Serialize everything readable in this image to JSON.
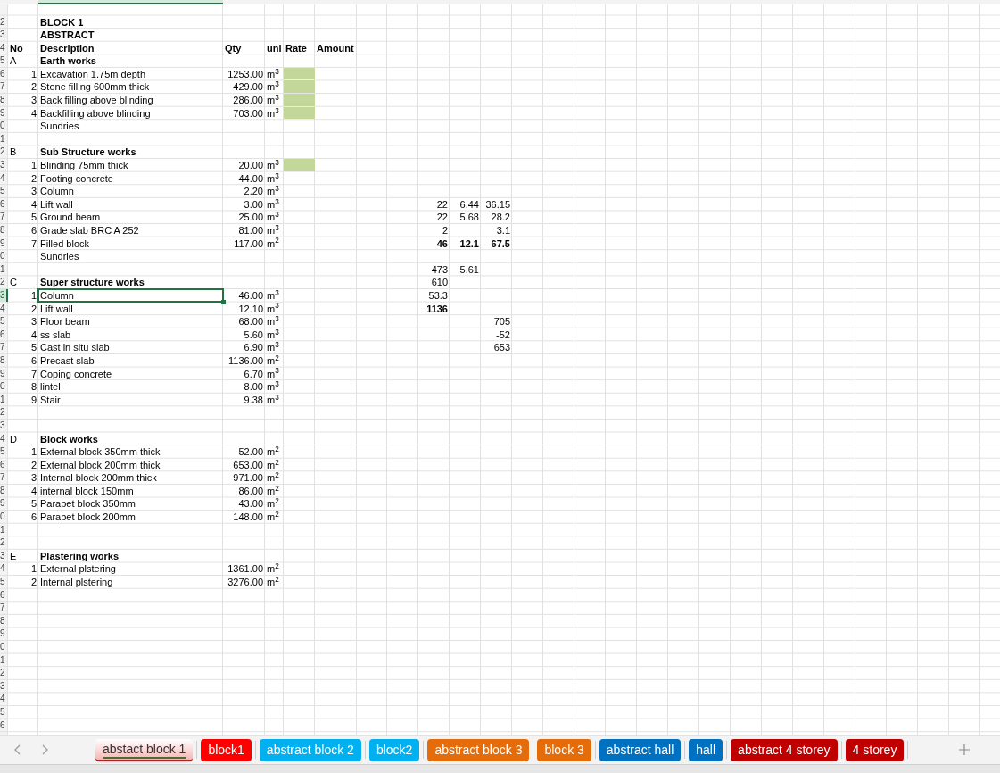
{
  "sheet": {
    "rows": [
      {
        "kind": "blank",
        "selected": false,
        "highlight": false
      },
      {
        "label": "2",
        "kind": "title",
        "selected": false,
        "highlight": false,
        "description": "BLOCK 1"
      },
      {
        "label": "3",
        "kind": "title",
        "selected": false,
        "highlight": false,
        "description": "ABSTRACT"
      },
      {
        "label": "4",
        "kind": "header",
        "selected": false,
        "highlight": false,
        "no": "No",
        "description": "Description",
        "qty": "Qty",
        "unit": "uni",
        "rate": "Rate",
        "amount": "Amount"
      },
      {
        "label": "5",
        "kind": "section",
        "selected": false,
        "highlight": false,
        "no": "A",
        "description": "Earth works"
      },
      {
        "label": "6",
        "kind": "item",
        "selected": false,
        "highlight": true,
        "no": "1",
        "description": "Excavation 1.75m depth",
        "qty": "1253.00",
        "unit": "m$^{3}$"
      },
      {
        "label": "7",
        "kind": "item",
        "selected": false,
        "highlight": true,
        "no": "2",
        "description": "Stone filling 600mm thick",
        "qty": "429.00",
        "unit": "m$^{3}$"
      },
      {
        "label": "8",
        "kind": "item",
        "selected": false,
        "highlight": true,
        "no": "3",
        "description": "Back filling above blinding",
        "qty": "286.00",
        "unit": "m$^{3}$"
      },
      {
        "label": "9",
        "kind": "item",
        "selected": false,
        "highlight": true,
        "no": "4",
        "description": "Backfilling above blinding",
        "qty": "703.00",
        "unit": "m$^{3}$"
      },
      {
        "label": "0",
        "kind": "item",
        "selected": false,
        "highlight": false,
        "description": "Sundries"
      },
      {
        "label": "1",
        "kind": "blank",
        "selected": false,
        "highlight": false
      },
      {
        "label": "2",
        "kind": "section",
        "selected": false,
        "highlight": false,
        "no": "B",
        "description": "Sub Structure works"
      },
      {
        "label": "3",
        "kind": "item",
        "selected": false,
        "highlight": true,
        "no": "1",
        "description": "Blinding 75mm thick",
        "qty": "20.00",
        "unit": "m$^{3}$"
      },
      {
        "label": "4",
        "kind": "item",
        "selected": false,
        "highlight": false,
        "no": "2",
        "description": "Footing concrete",
        "qty": "44.00",
        "unit": "m$^{3}$"
      },
      {
        "label": "5",
        "kind": "item",
        "selected": false,
        "highlight": false,
        "no": "3",
        "description": "Column",
        "qty": "2.20",
        "unit": "m$^{3}$"
      },
      {
        "label": "6",
        "kind": "item",
        "selected": false,
        "highlight": false,
        "no": "4",
        "description": "Lift wall",
        "qty": "3.00",
        "unit": "m$^{3}$",
        "side": {
          "i": "22",
          "j": "6.44",
          "k": "36.15",
          "bold": false
        }
      },
      {
        "label": "7",
        "kind": "item",
        "selected": false,
        "highlight": false,
        "no": "5",
        "description": "Ground beam",
        "qty": "25.00",
        "unit": "m$^{3}$",
        "side": {
          "i": "22",
          "j": "5.68",
          "k": "28.2",
          "bold": false
        }
      },
      {
        "label": "8",
        "kind": "item",
        "selected": false,
        "highlight": false,
        "no": "6",
        "description": "Grade slab BRC A 252",
        "qty": "81.00",
        "unit": "m$^{3}$",
        "side": {
          "i": "2",
          "k": "3.1",
          "bold": false
        }
      },
      {
        "label": "9",
        "kind": "item",
        "selected": false,
        "highlight": false,
        "no": "7",
        "description": "Filled block",
        "qty": "117.00",
        "unit": "m$^{2}$",
        "side": {
          "i": "46",
          "j": "12.1",
          "k": "67.5",
          "bold": true
        }
      },
      {
        "label": "0",
        "kind": "item",
        "selected": false,
        "highlight": false,
        "description": "Sundries"
      },
      {
        "label": "1",
        "kind": "blank",
        "selected": false,
        "highlight": false,
        "side": {
          "i": "473",
          "j": "5.61",
          "bold": false
        }
      },
      {
        "label": "2",
        "kind": "section",
        "selected": false,
        "highlight": false,
        "no": "C",
        "description": "Super structure works",
        "side": {
          "i": "610",
          "bold": false
        }
      },
      {
        "label": "3",
        "kind": "item",
        "selected": true,
        "highlight": false,
        "no": "1",
        "description": "Column",
        "qty": "46.00",
        "unit": "m$^{3}$",
        "side": {
          "i": "53.3",
          "bold": false
        }
      },
      {
        "label": "4",
        "kind": "item",
        "selected": false,
        "highlight": false,
        "no": "2",
        "description": "Lift wall",
        "qty": "12.10",
        "unit": "m$^{3}$",
        "side": {
          "i": "1136",
          "bold": true
        }
      },
      {
        "label": "5",
        "kind": "item",
        "selected": false,
        "highlight": false,
        "no": "3",
        "description": "Floor beam",
        "qty": "68.00",
        "unit": "m$^{3}$",
        "side": {
          "k": "705",
          "bold": false
        }
      },
      {
        "label": "6",
        "kind": "item",
        "selected": false,
        "highlight": false,
        "no": "4",
        "description": "ss slab",
        "qty": "5.60",
        "unit": "m$^{3}$",
        "side": {
          "k": "-52",
          "bold": false
        }
      },
      {
        "label": "7",
        "kind": "item",
        "selected": false,
        "highlight": false,
        "no": "5",
        "description": "Cast in situ slab",
        "qty": "6.90",
        "unit": "m$^{3}$",
        "side": {
          "k": "653",
          "bold": false
        }
      },
      {
        "label": "8",
        "kind": "item",
        "selected": false,
        "highlight": false,
        "no": "6",
        "description": "Precast slab",
        "qty": "1136.00",
        "unit": "m$^{2}$"
      },
      {
        "label": "9",
        "kind": "item",
        "selected": false,
        "highlight": false,
        "no": "7",
        "description": "Coping concrete",
        "qty": "6.70",
        "unit": "m$^{3}$"
      },
      {
        "label": "0",
        "kind": "item",
        "selected": false,
        "highlight": false,
        "no": "8",
        "description": "lintel",
        "qty": "8.00",
        "unit": "m$^{3}$"
      },
      {
        "label": "1",
        "kind": "item",
        "selected": false,
        "highlight": false,
        "no": "9",
        "description": "Stair",
        "qty": "9.38",
        "unit": "m$^{3}$"
      },
      {
        "label": "2",
        "kind": "blank",
        "selected": false,
        "highlight": false
      },
      {
        "label": "3",
        "kind": "blank",
        "selected": false,
        "highlight": false
      },
      {
        "label": "4",
        "kind": "section",
        "selected": false,
        "highlight": false,
        "no": "D",
        "description": "Block works"
      },
      {
        "label": "5",
        "kind": "item",
        "selected": false,
        "highlight": false,
        "no": "1",
        "description": "External block 350mm thick",
        "qty": "52.00",
        "unit": "m$^{2}$"
      },
      {
        "label": "6",
        "kind": "item",
        "selected": false,
        "highlight": false,
        "no": "2",
        "description": "External block 200mm thick",
        "qty": "653.00",
        "unit": "m$^{2}$"
      },
      {
        "label": "7",
        "kind": "item",
        "selected": false,
        "highlight": false,
        "no": "3",
        "description": "Internal block 200mm thick",
        "qty": "971.00",
        "unit": "m$^{2}$"
      },
      {
        "label": "8",
        "kind": "item",
        "selected": false,
        "highlight": false,
        "no": "4",
        "description": "internal block 150mm",
        "qty": "86.00",
        "unit": "m$^{2}$"
      },
      {
        "label": "9",
        "kind": "item",
        "selected": false,
        "highlight": false,
        "no": "5",
        "description": "Parapet block 350mm",
        "qty": "43.00",
        "unit": "m$^{2}$"
      },
      {
        "label": "0",
        "kind": "item",
        "selected": false,
        "highlight": false,
        "no": "6",
        "description": "Parapet block 200mm",
        "qty": "148.00",
        "unit": "m$^{2}$"
      },
      {
        "label": "1",
        "kind": "blank",
        "selected": false,
        "highlight": false
      },
      {
        "label": "2",
        "kind": "blank",
        "selected": false,
        "highlight": false
      },
      {
        "label": "3",
        "kind": "section",
        "selected": false,
        "highlight": false,
        "no": "E",
        "description": "Plastering works"
      },
      {
        "label": "4",
        "kind": "item",
        "selected": false,
        "highlight": false,
        "no": "1",
        "description": "External plstering",
        "qty": "1361.00",
        "unit": "m$^{2}$"
      },
      {
        "label": "5",
        "kind": "item",
        "selected": false,
        "highlight": false,
        "no": "2",
        "description": "Internal plstering",
        "qty": "3276.00",
        "unit": "m$^{2}$"
      },
      {
        "label": "6",
        "kind": "blank",
        "selected": false,
        "highlight": false
      },
      {
        "label": "7",
        "kind": "blank",
        "selected": false,
        "highlight": false
      },
      {
        "label": "8",
        "kind": "blank",
        "selected": false,
        "highlight": false
      },
      {
        "label": "9",
        "kind": "blank",
        "selected": false,
        "highlight": false
      },
      {
        "label": "0",
        "kind": "blank",
        "selected": false,
        "highlight": false
      },
      {
        "label": "1",
        "kind": "blank",
        "selected": false,
        "highlight": false
      },
      {
        "label": "2",
        "kind": "blank",
        "selected": false,
        "highlight": false
      },
      {
        "label": "3",
        "kind": "blank",
        "selected": false,
        "highlight": false
      },
      {
        "label": "4",
        "kind": "blank",
        "selected": false,
        "highlight": false
      },
      {
        "label": "5",
        "kind": "blank",
        "selected": false,
        "highlight": false
      },
      {
        "label": "6",
        "kind": "blank",
        "selected": false,
        "highlight": false
      }
    ]
  },
  "sheet_tabs": [
    {
      "label": "abstact block 1",
      "color": "#ff0000",
      "selected": true
    },
    {
      "label": "block1",
      "color": "#ff0000",
      "selected": false
    },
    {
      "label": "abstract block 2",
      "color": "#00b0f0",
      "selected": false
    },
    {
      "label": "block2",
      "color": "#00b0f0",
      "selected": false
    },
    {
      "label": "abstract block 3",
      "color": "#e46c0a",
      "selected": false
    },
    {
      "label": "block 3",
      "color": "#e46c0a",
      "selected": false
    },
    {
      "label": "abstract hall",
      "color": "#0070c0",
      "selected": false
    },
    {
      "label": "hall",
      "color": "#0070c0",
      "selected": false
    },
    {
      "label": "abstract 4 storey",
      "color": "#c00000",
      "selected": false
    },
    {
      "label": "4 storey",
      "color": "#c00000",
      "selected": false
    }
  ]
}
